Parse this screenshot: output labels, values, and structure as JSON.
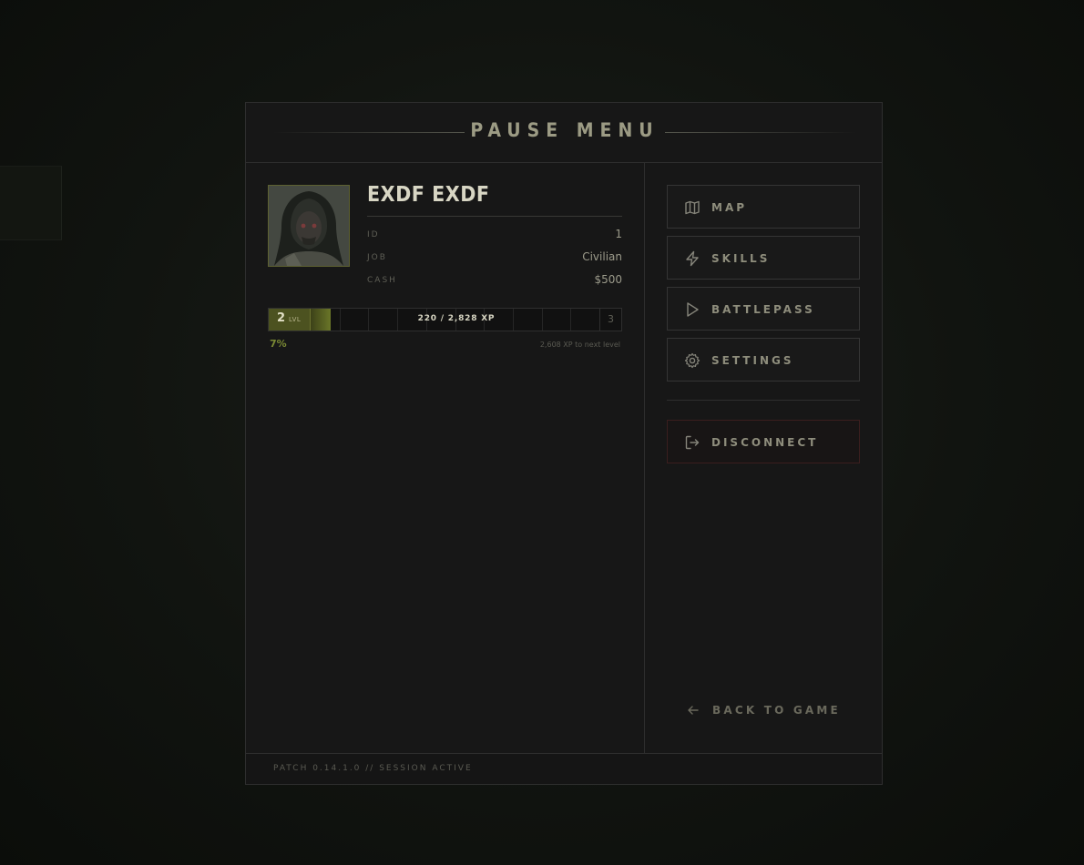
{
  "header": {
    "title": "PAUSE MENU"
  },
  "player": {
    "name": "EXDF EXDF",
    "stats": [
      {
        "key": "ID",
        "value": "1"
      },
      {
        "key": "JOB",
        "value": "Civilian"
      },
      {
        "key": "CASH",
        "value": "$500"
      }
    ]
  },
  "progress": {
    "level": "2",
    "level_label": "LVL",
    "next_level": "3",
    "xp_text": "220 / 2,828 XP",
    "fraction": 0.07,
    "percent_text": "7%",
    "to_next_text": "2,608 XP to next level"
  },
  "menu": {
    "map": "MAP",
    "skills": "SKILLS",
    "battlepass": "BATTLEPASS",
    "settings": "SETTINGS",
    "disconnect": "DISCONNECT",
    "back": "BACK TO GAME"
  },
  "footer": {
    "patch": "PATCH 0.14.1.0 // SESSION ACTIVE"
  },
  "colors": {
    "accent": "#6a7628",
    "danger_border": "#3b1e1e",
    "title": "#9c9b84"
  },
  "icons": {
    "map": "map-icon",
    "skills": "lightning-icon",
    "battlepass": "play-icon",
    "settings": "gear-icon",
    "disconnect": "logout-icon",
    "back": "arrow-left-icon"
  }
}
